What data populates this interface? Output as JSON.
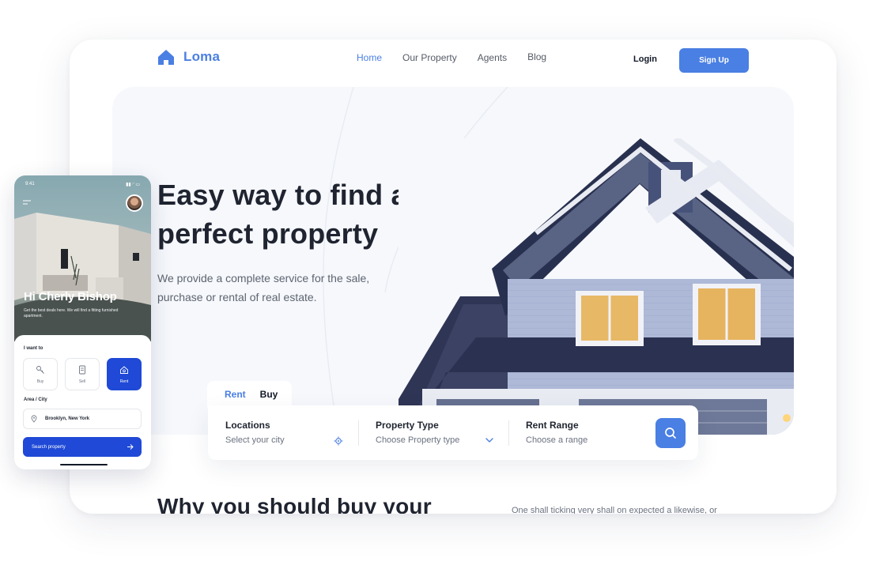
{
  "brand": {
    "name": "Loma",
    "accent": "#4a7fe3"
  },
  "nav": {
    "links": [
      {
        "label": "Home"
      },
      {
        "label": "Our Property"
      },
      {
        "label": "Agents"
      },
      {
        "label": "Blog"
      }
    ],
    "login": "Login",
    "signup": "Sign Up"
  },
  "hero": {
    "title": "Easy way to find a perfect property",
    "subtitle": "We provide a complete service for the sale, purchase or rental of real estate."
  },
  "search": {
    "tabs": [
      "Rent",
      "Buy"
    ],
    "fields": [
      {
        "label": "Locations",
        "value": "Select your city"
      },
      {
        "label": "Property Type",
        "value": "Choose Property type"
      },
      {
        "label": "Rent Range",
        "value": "Choose a range"
      }
    ]
  },
  "why": {
    "title": "Why you should buy your",
    "text": "One shall ticking very shall on expected a likewise, or"
  },
  "phone": {
    "time": "9:41",
    "greeting": "Hi Cherly Bishop",
    "subtitle": "Get the best deals here. We will find a fitting furnished apartment.",
    "intent_label": "I want to",
    "intents": [
      "Buy",
      "Sell",
      "Rent"
    ],
    "area_label": "Area / City",
    "area_value": "Brooklyn, New York",
    "button": "Search property",
    "primary": "#1f49d6"
  }
}
